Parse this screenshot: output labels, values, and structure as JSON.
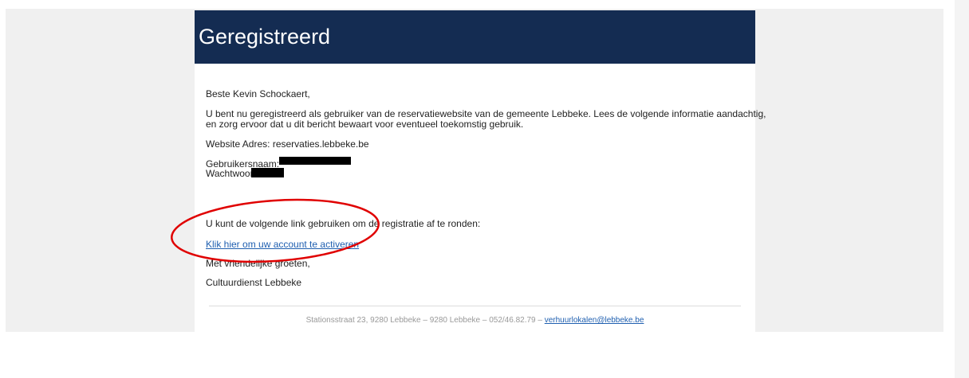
{
  "header": {
    "title": "Geregistreerd"
  },
  "message": {
    "greeting": "Beste Kevin Schockaert,",
    "intro_line1": "U bent nu geregistreerd als gebruiker van de reservatiewebsite van de gemeente Lebbeke. Lees de volgende informatie aandachtig,",
    "intro_line2": "en zorg ervoor dat u dit bericht bewaart voor eventueel toekomstig gebruik.",
    "website_label": "Website Adres: reservaties.lebbeke.be",
    "username_label": "Gebruikersnaam:",
    "password_label": "Wachtwoord:",
    "link_intro": "U kunt de volgende link gebruiken om de registratie af te ronden:",
    "activate_link": "Klik hier om uw account te activeren",
    "closing": "Met vriendelijke groeten,",
    "signature": "Cultuurdienst Lebbeke"
  },
  "footer": {
    "address": "Stationsstraat 23, 9280 Lebbeke – 9280 Lebbeke – 052/46.82.79 –",
    "email": "verhuurlokalen@lebbeke.be"
  },
  "annotation": {
    "color": "#e00000"
  },
  "colors": {
    "header_bg": "#142c52",
    "link": "#1f5fb0"
  }
}
